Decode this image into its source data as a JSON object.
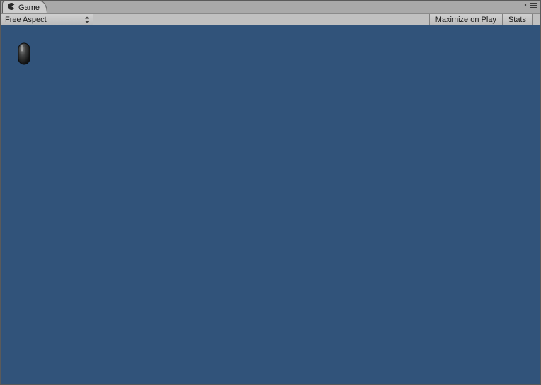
{
  "tab": {
    "label": "Game"
  },
  "toolbar": {
    "aspect_label": "Free Aspect",
    "maximize_label": "Maximize on Play",
    "stats_label": "Stats"
  },
  "colors": {
    "viewport_bg": "#31537a"
  }
}
